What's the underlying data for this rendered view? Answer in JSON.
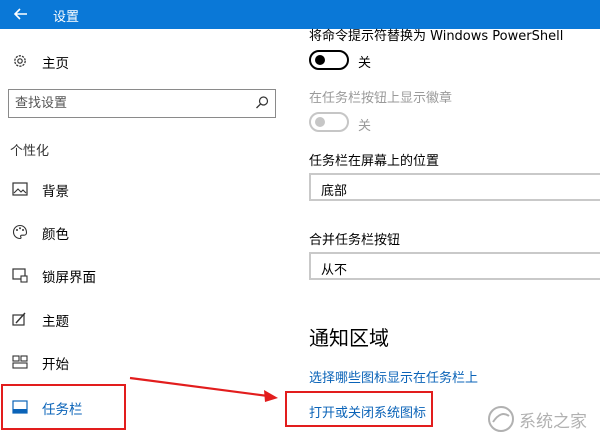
{
  "window": {
    "title": "设置"
  },
  "sidebar": {
    "home_label": "主页",
    "search_placeholder": "查找设置",
    "section_label": "个性化",
    "items": [
      {
        "label": "背景",
        "icon": "picture-icon"
      },
      {
        "label": "颜色",
        "icon": "palette-icon"
      },
      {
        "label": "锁屏界面",
        "icon": "lock-screen-icon"
      },
      {
        "label": "主题",
        "icon": "theme-brush-icon"
      },
      {
        "label": "开始",
        "icon": "start-grid-icon"
      },
      {
        "label": "任务栏",
        "icon": "taskbar-icon",
        "selected": true
      }
    ]
  },
  "main": {
    "powershell_label": "将命令提示符替换为 Windows PowerShell",
    "powershell_toggle_state": "关",
    "badges_label": "在任务栏按钮上显示徽章",
    "badges_toggle_state": "关",
    "position_label": "任务栏在屏幕上的位置",
    "position_value": "底部",
    "combine_label": "合并任务栏按钮",
    "combine_value": "从不",
    "notification_heading": "通知区域",
    "link_select_icons": "选择哪些图标显示在任务栏上",
    "link_system_icons": "打开或关闭系统图标"
  },
  "watermark": {
    "text": "系统之家"
  },
  "colors": {
    "titlebar": "#0a78d7",
    "link": "#0a63b8",
    "highlight": "#e21d1d"
  }
}
